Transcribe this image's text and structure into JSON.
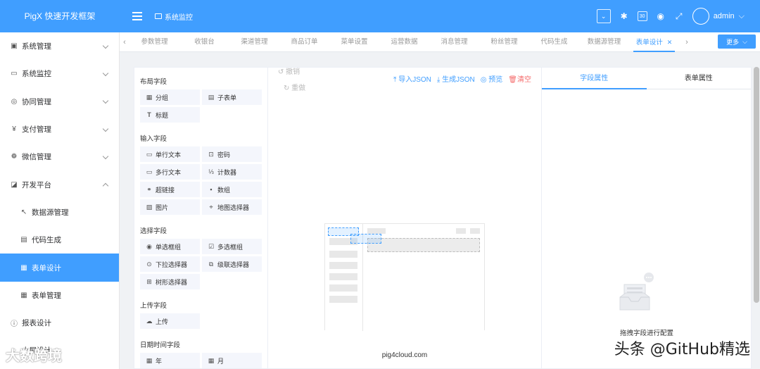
{
  "app": {
    "brand": "PigX 快速开发框架"
  },
  "header": {
    "breadcrumb": "系统监控",
    "user": "admin",
    "icons": [
      "expand-icon",
      "bug-icon",
      "calendar-icon",
      "eye-icon",
      "fullscreen-icon"
    ]
  },
  "sidebar": {
    "items": [
      {
        "label": "系统管理",
        "icon": "image-icon"
      },
      {
        "label": "系统监控",
        "icon": "monitor-icon"
      },
      {
        "label": "协同管理",
        "icon": "radio-icon"
      },
      {
        "label": "支付管理",
        "icon": "yen-icon"
      },
      {
        "label": "微信管理",
        "icon": "wechat-icon"
      },
      {
        "label": "开发平台",
        "icon": "tools-icon"
      },
      {
        "label": "数据源管理",
        "icon": "cursor-icon"
      },
      {
        "label": "代码生成",
        "icon": "window-icon"
      },
      {
        "label": "表单设计",
        "icon": "form-icon"
      },
      {
        "label": "表单管理",
        "icon": "grid-icon"
      },
      {
        "label": "报表设计",
        "icon": "info-icon"
      },
      {
        "label": "大屏设计",
        "icon": "screen-icon"
      }
    ]
  },
  "tabs": {
    "items": [
      "参数管理",
      "收银台",
      "渠道管理",
      "商品订单",
      "菜单设置",
      "运营数据",
      "消息管理",
      "粉丝管理",
      "代码生成",
      "数据源管理",
      "表单设计"
    ],
    "active": "表单设计",
    "more": "更多"
  },
  "designer": {
    "groups": [
      {
        "title": "布局字段",
        "items": [
          "分组",
          "子表单",
          "标题"
        ]
      },
      {
        "title": "输入字段",
        "items": [
          "单行文本",
          "密码",
          "多行文本",
          "计数器",
          "超链接",
          "数组",
          "图片",
          "地图选择器"
        ]
      },
      {
        "title": "选择字段",
        "items": [
          "单选框组",
          "多选框组",
          "下拉选择器",
          "级联选择器",
          "树形选择器"
        ]
      },
      {
        "title": "上传字段",
        "items": [
          "上传"
        ]
      },
      {
        "title": "日期时间字段",
        "items": [
          "年",
          "月"
        ]
      }
    ],
    "toolbar": {
      "import": "导入JSON",
      "generate": "生成JSON",
      "preview": "预览",
      "clear": "清空"
    },
    "undo": "撤销",
    "redo": "重做",
    "canvas_caption": "pig4cloud.com",
    "right_tabs": [
      "字段属性",
      "表单属性"
    ],
    "right_empty": "拖拽字段进行配置"
  },
  "watermarks": {
    "bottom_right": "头条 @GitHub精选",
    "bottom_left": "大数跨境"
  }
}
